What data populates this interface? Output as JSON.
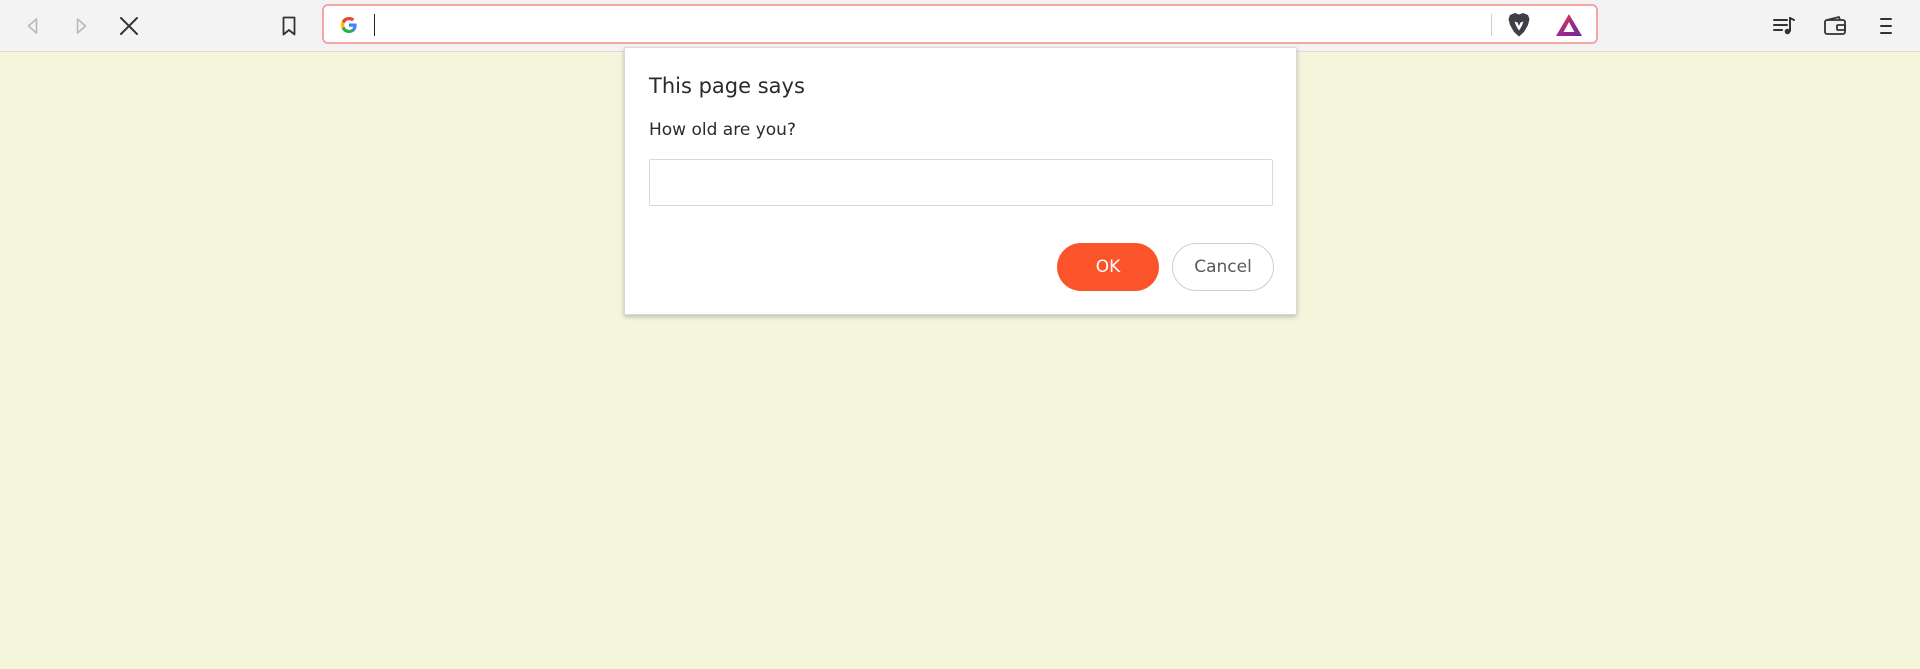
{
  "toolbar": {
    "icons": {
      "back": "back-arrow-icon",
      "forward": "forward-arrow-icon",
      "stop": "stop-loading-icon",
      "bookmark": "bookmark-icon",
      "playlist": "playlist-icon",
      "wallet": "wallet-icon",
      "menu": "menu-icon"
    }
  },
  "omnibox": {
    "search_engine_icon": "google-icon",
    "value": "",
    "shields_icon": "brave-shields-icon",
    "rewards_icon": "brave-rewards-icon"
  },
  "dialog": {
    "title": "This page says",
    "message": "How old are you?",
    "input_value": "",
    "ok_label": "OK",
    "cancel_label": "Cancel"
  },
  "colors": {
    "page_background": "#f5f5dc",
    "accent": "#fb542b",
    "omnibox_focus_border": "#f3a8a4"
  }
}
